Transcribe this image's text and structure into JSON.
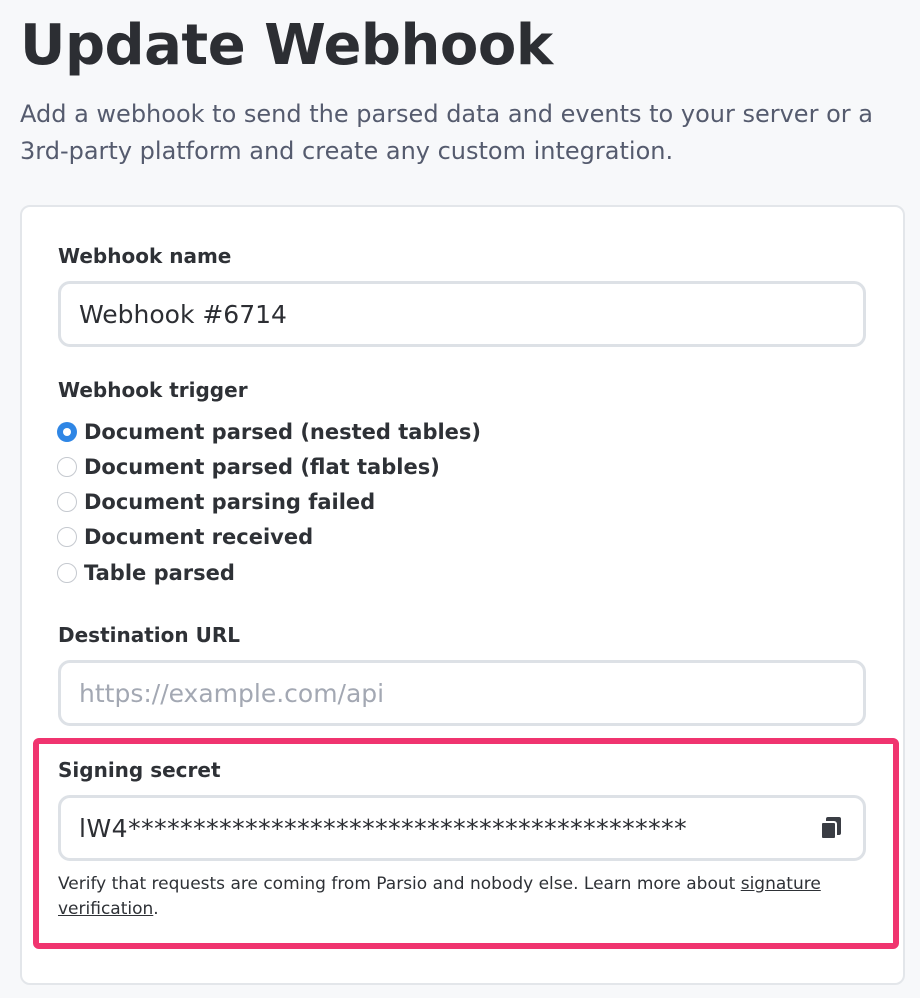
{
  "header": {
    "title": "Update Webhook",
    "description": "Add a webhook to send the parsed data and events to your server or a 3rd-party platform and create any custom integration."
  },
  "form": {
    "name": {
      "label": "Webhook name",
      "value": "Webhook #6714"
    },
    "trigger": {
      "label": "Webhook trigger",
      "selected": "Document parsed (nested tables)",
      "options": [
        "Document parsed (nested tables)",
        "Document parsed (flat tables)",
        "Document parsing failed",
        "Document received",
        "Table parsed"
      ]
    },
    "destination": {
      "label": "Destination URL",
      "value": "",
      "placeholder": "https://example.com/api"
    },
    "secret": {
      "label": "Signing secret",
      "value": "lW4*******************************************",
      "copy_icon": "copy-icon",
      "help_prefix": "Verify that requests are coming from Parsio and nobody else. Learn more about ",
      "help_link": "signature verification",
      "help_suffix": "."
    }
  },
  "colors": {
    "highlight": "#f0346f",
    "radio_checked": "#2f86e5"
  }
}
